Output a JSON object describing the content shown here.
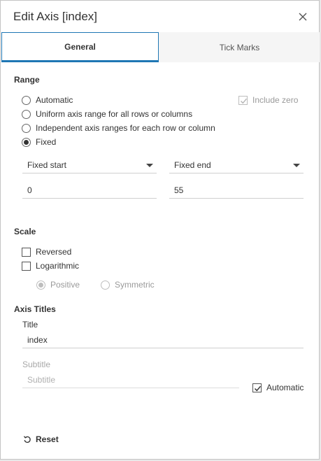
{
  "dialog": {
    "title": "Edit Axis [index]"
  },
  "tabs": [
    {
      "label": "General",
      "active": true
    },
    {
      "label": "Tick Marks",
      "active": false
    }
  ],
  "range": {
    "heading": "Range",
    "include_zero": {
      "label": "Include zero",
      "checked": true,
      "disabled": true
    },
    "options": [
      {
        "label": "Automatic",
        "checked": false
      },
      {
        "label": "Uniform axis range for all rows or columns",
        "checked": false
      },
      {
        "label": "Independent axis ranges for each row or column",
        "checked": false
      },
      {
        "label": "Fixed",
        "checked": true
      }
    ],
    "start_select": "Fixed start",
    "end_select": "Fixed end",
    "start_value": "0",
    "end_value": "55"
  },
  "scale": {
    "heading": "Scale",
    "reversed": {
      "label": "Reversed",
      "checked": false
    },
    "logarithmic": {
      "label": "Logarithmic",
      "checked": false
    },
    "positive": {
      "label": "Positive",
      "checked": true,
      "disabled": true
    },
    "symmetric": {
      "label": "Symmetric",
      "checked": false,
      "disabled": true
    }
  },
  "axis_titles": {
    "heading": "Axis Titles",
    "title_label": "Title",
    "title_value": "index",
    "subtitle_label": "Subtitle",
    "subtitle_placeholder": "Subtitle",
    "automatic": {
      "label": "Automatic",
      "checked": true
    }
  },
  "footer": {
    "reset_label": "Reset"
  },
  "colors": {
    "accent": "#1f77b4",
    "tab_bar_bg": "#f5f5f5"
  }
}
